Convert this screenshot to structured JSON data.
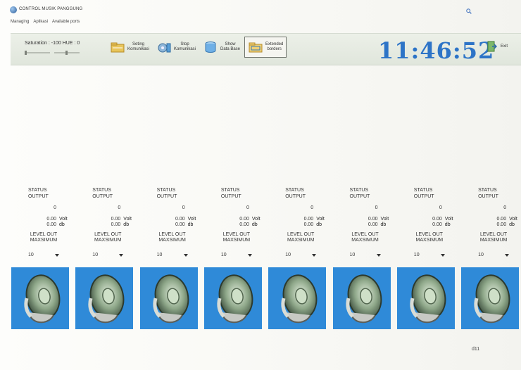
{
  "window": {
    "title": "CONTROL MUSIK PANGGUNG"
  },
  "menu": {
    "items": [
      "Managing",
      "Aplikasi",
      "Available ports"
    ]
  },
  "toolbar": {
    "saturation_text": "Saturation : -100  HUE : 0",
    "buttons": [
      {
        "label_line1": "Seting",
        "label_line2": "Komunikasi"
      },
      {
        "label_line1": "Stop",
        "label_line2": "Komunikasi"
      },
      {
        "label_line1": "Show",
        "label_line2": "Data Base"
      },
      {
        "label_line1": "Extended",
        "label_line2": "borders"
      }
    ],
    "clock": "11:46:52",
    "exit_label": "Exit"
  },
  "channels": [
    {
      "status_line1": "STATUS",
      "status_line2": "OUTPUT",
      "value": "0",
      "volt": "0.00",
      "volt_unit": "Volt",
      "db": "0.00",
      "db_unit": "db",
      "level_line1": "LEVEL OUT",
      "level_line2": "MAXSIMUM",
      "level_value": "10"
    },
    {
      "status_line1": "STATUS",
      "status_line2": "OUTPUT",
      "value": "0",
      "volt": "0.00",
      "volt_unit": "Volt",
      "db": "0.00",
      "db_unit": "db",
      "level_line1": "LEVEL OUT",
      "level_line2": "MAXSIMUM",
      "level_value": "10"
    },
    {
      "status_line1": "STATUS",
      "status_line2": "OUTPUT",
      "value": "0",
      "volt": "0.00",
      "volt_unit": "Volt",
      "db": "0.00",
      "db_unit": "db",
      "level_line1": "LEVEL OUT",
      "level_line2": "MAXSIMUM",
      "level_value": "10"
    },
    {
      "status_line1": "STATUS",
      "status_line2": "OUTPUT",
      "value": "0",
      "volt": "0.00",
      "volt_unit": "Volt",
      "db": "0.00",
      "db_unit": "db",
      "level_line1": "LEVEL OUT",
      "level_line2": "MAXSIMUM",
      "level_value": "10"
    },
    {
      "status_line1": "STATUS",
      "status_line2": "OUTPUT",
      "value": "0",
      "volt": "0.00",
      "volt_unit": "Volt",
      "db": "0.00",
      "db_unit": "db",
      "level_line1": "LEVEL OUT",
      "level_line2": "MAXSIMUM",
      "level_value": "10"
    },
    {
      "status_line1": "STATUS",
      "status_line2": "OUTPUT",
      "value": "0",
      "volt": "0.00",
      "volt_unit": "Volt",
      "db": "0.00",
      "db_unit": "db",
      "level_line1": "LEVEL OUT",
      "level_line2": "MAXSIMUM",
      "level_value": "10"
    },
    {
      "status_line1": "STATUS",
      "status_line2": "OUTPUT",
      "value": "0",
      "volt": "0.00",
      "volt_unit": "Volt",
      "db": "0.00",
      "db_unit": "db",
      "level_line1": "LEVEL OUT",
      "level_line2": "MAXSIMUM",
      "level_value": "10"
    },
    {
      "status_line1": "STATUS",
      "status_line2": "OUTPUT",
      "value": "0",
      "volt": "0.00",
      "volt_unit": "Volt",
      "db": "0.00",
      "db_unit": "db",
      "level_line1": "LEVEL OUT",
      "level_line2": "MAXSIMUM",
      "level_value": "10"
    }
  ],
  "footnote": "d11",
  "colors": {
    "clock": "#2d74c7",
    "speaker_bg": "#2f8ad8",
    "toolbar_bg": "#e6ebe2"
  },
  "icons": [
    "app-globe-icon",
    "search-icon",
    "folder-settings-icon",
    "gear-stop-icon",
    "database-icon",
    "folder-borders-icon",
    "exit-door-icon",
    "speaker-icon"
  ]
}
